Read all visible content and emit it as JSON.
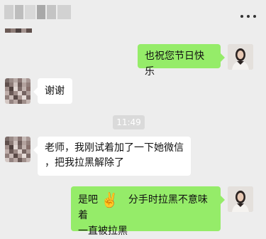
{
  "header": {
    "title_blur_colors": [
      "#c9c9c9",
      "#b8b8b8",
      "#d4d4d4",
      "#a9a9a9",
      "#cfcfcf",
      "#bdbdbd"
    ],
    "more_icon": "more-dots-icon"
  },
  "messages": [
    {
      "from": "me",
      "text": "也祝您节日快乐"
    },
    {
      "from": "other",
      "text": "谢谢"
    },
    {
      "type": "time",
      "text": "11:49"
    },
    {
      "from": "other",
      "line1": "老师，我刚试着加了一下她微信",
      "line2": "，把我拉黑解除了"
    },
    {
      "from": "me",
      "line1_pre": "是吧",
      "emoji": "✌️",
      "line1_post": "分手时拉黑不意味着",
      "line2": "一直被拉黑"
    }
  ],
  "colors": {
    "green_bubble": "#95ec69",
    "white_bubble": "#ffffff",
    "background": "#ededed"
  }
}
